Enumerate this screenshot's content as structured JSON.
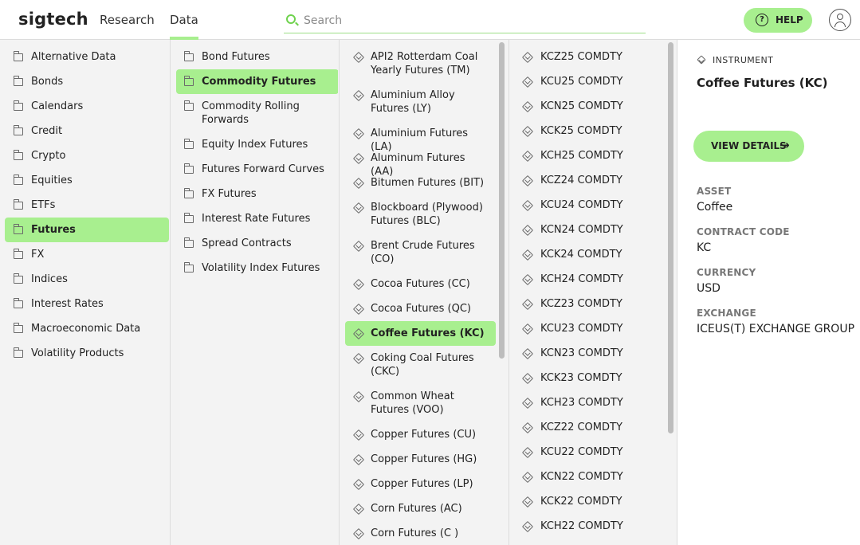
{
  "header": {
    "logo": "sigtech",
    "nav": [
      "Research",
      "Data"
    ],
    "search_placeholder": "Search",
    "help_label": "HELP"
  },
  "icons": {
    "folder": "folder-icon",
    "instrument": "cube-icon",
    "help": "question-circle-icon",
    "user": "user-icon",
    "search": "search-icon",
    "arrow": "arrow-right-icon"
  },
  "colors": {
    "accent": "#a8ef8f",
    "search_icon": "#6fd24e"
  },
  "categories": [
    "Alternative Data",
    "Bonds",
    "Calendars",
    "Credit",
    "Crypto",
    "Equities",
    "ETFs",
    "Futures",
    "FX",
    "Indices",
    "Interest Rates",
    "Macroeconomic Data",
    "Volatility Products"
  ],
  "subcategories": [
    "Bond Futures",
    "Commodity Futures",
    "Commodity Rolling Forwards",
    "Equity Index Futures",
    "Futures Forward Curves",
    "FX Futures",
    "Interest Rate Futures",
    "Spread Contracts",
    "Volatility Index Futures"
  ],
  "groups": [
    "API2 Rotterdam Coal Yearly Futures (TM)",
    "Aluminium Alloy Futures (LY)",
    "Aluminium Futures (LA)",
    "Aluminum Futures (AA)",
    "Bitumen Futures (BIT)",
    "Blockboard (Plywood) Futures (BLC)",
    "Brent Crude Futures (CO)",
    "Cocoa Futures (CC)",
    "Cocoa Futures (QC)",
    "Coffee Futures (KC)",
    "Coking Coal Futures (CKC)",
    "Common Wheat Futures (VOO)",
    "Copper Futures (CU)",
    "Copper Futures (HG)",
    "Copper Futures (LP)",
    "Corn Futures (AC)",
    "Corn Futures (C )"
  ],
  "contracts": [
    "KCZ25 COMDTY",
    "KCU25 COMDTY",
    "KCN25 COMDTY",
    "KCK25 COMDTY",
    "KCH25 COMDTY",
    "KCZ24 COMDTY",
    "KCU24 COMDTY",
    "KCN24 COMDTY",
    "KCK24 COMDTY",
    "KCH24 COMDTY",
    "KCZ23 COMDTY",
    "KCU23 COMDTY",
    "KCN23 COMDTY",
    "KCK23 COMDTY",
    "KCH23 COMDTY",
    "KCZ22 COMDTY",
    "KCU22 COMDTY",
    "KCN22 COMDTY",
    "KCK22 COMDTY",
    "KCH22 COMDTY"
  ],
  "detail": {
    "type_label": "INSTRUMENT",
    "title": "Coffee Futures (KC)",
    "button_label": "VIEW DETAILS",
    "arrow": "→",
    "fields": [
      {
        "label": "ASSET",
        "value": "Coffee"
      },
      {
        "label": "CONTRACT CODE",
        "value": "KC"
      },
      {
        "label": "CURRENCY",
        "value": "USD"
      },
      {
        "label": "EXCHANGE",
        "value": "ICEUS(T) EXCHANGE GROUP"
      }
    ]
  }
}
